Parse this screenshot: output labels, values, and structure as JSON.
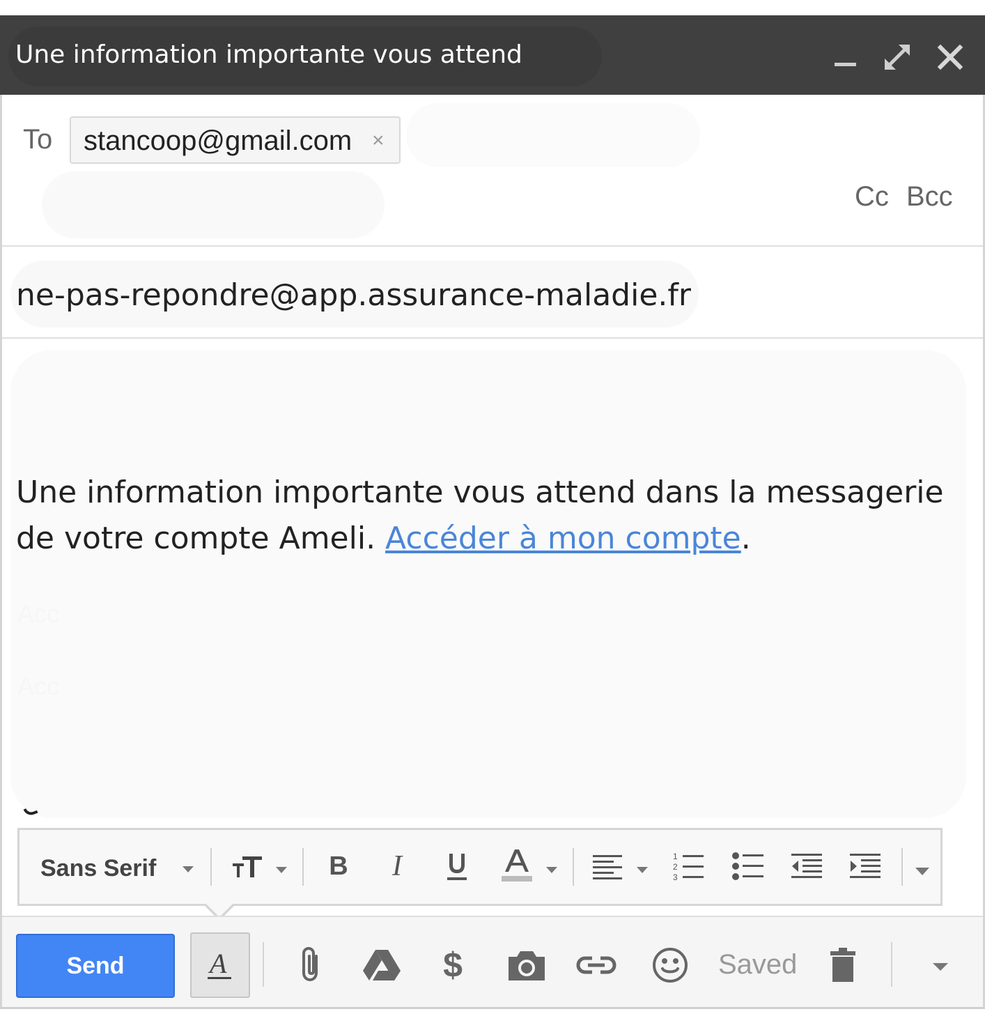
{
  "window": {
    "title": "Une information importante vous attend",
    "controls": [
      "minimize-icon",
      "expand-icon",
      "close-icon"
    ]
  },
  "recipients": {
    "to_label": "To",
    "to_chips": [
      {
        "email": "stancoop@gmail.com",
        "remove_glyph": "×"
      }
    ],
    "cc_label": "Cc",
    "bcc_label": "Bcc"
  },
  "subject": {
    "value": "ne-pas-repondre@app.assurance-maladie.fr"
  },
  "body": {
    "text_before_link": "Une information importante vous attend dans la messagerie de votre compte Ameli. ",
    "link_text": "Accéder à mon compte",
    "text_after_link": ".",
    "faint_lines": [
      "Acc",
      "Acc"
    ],
    "link_color": "#4a86d8"
  },
  "format_toolbar": {
    "font_family": "Sans Serif",
    "buttons": [
      "text-size-icon",
      "bold-icon",
      "italic-icon",
      "underline-icon",
      "text-color-icon",
      "align-icon",
      "numbered-list-icon",
      "bulleted-list-icon",
      "indent-less-icon",
      "indent-more-icon",
      "more-formatting-icon"
    ]
  },
  "bottom_bar": {
    "send_label": "Send",
    "status": "Saved",
    "send_color": "#4285f4",
    "icons": [
      "formatting-options-icon",
      "attach-file-icon",
      "google-drive-icon",
      "money-icon",
      "camera-icon",
      "insert-link-icon",
      "emoji-icon",
      "trash-icon",
      "more-options-icon"
    ]
  }
}
